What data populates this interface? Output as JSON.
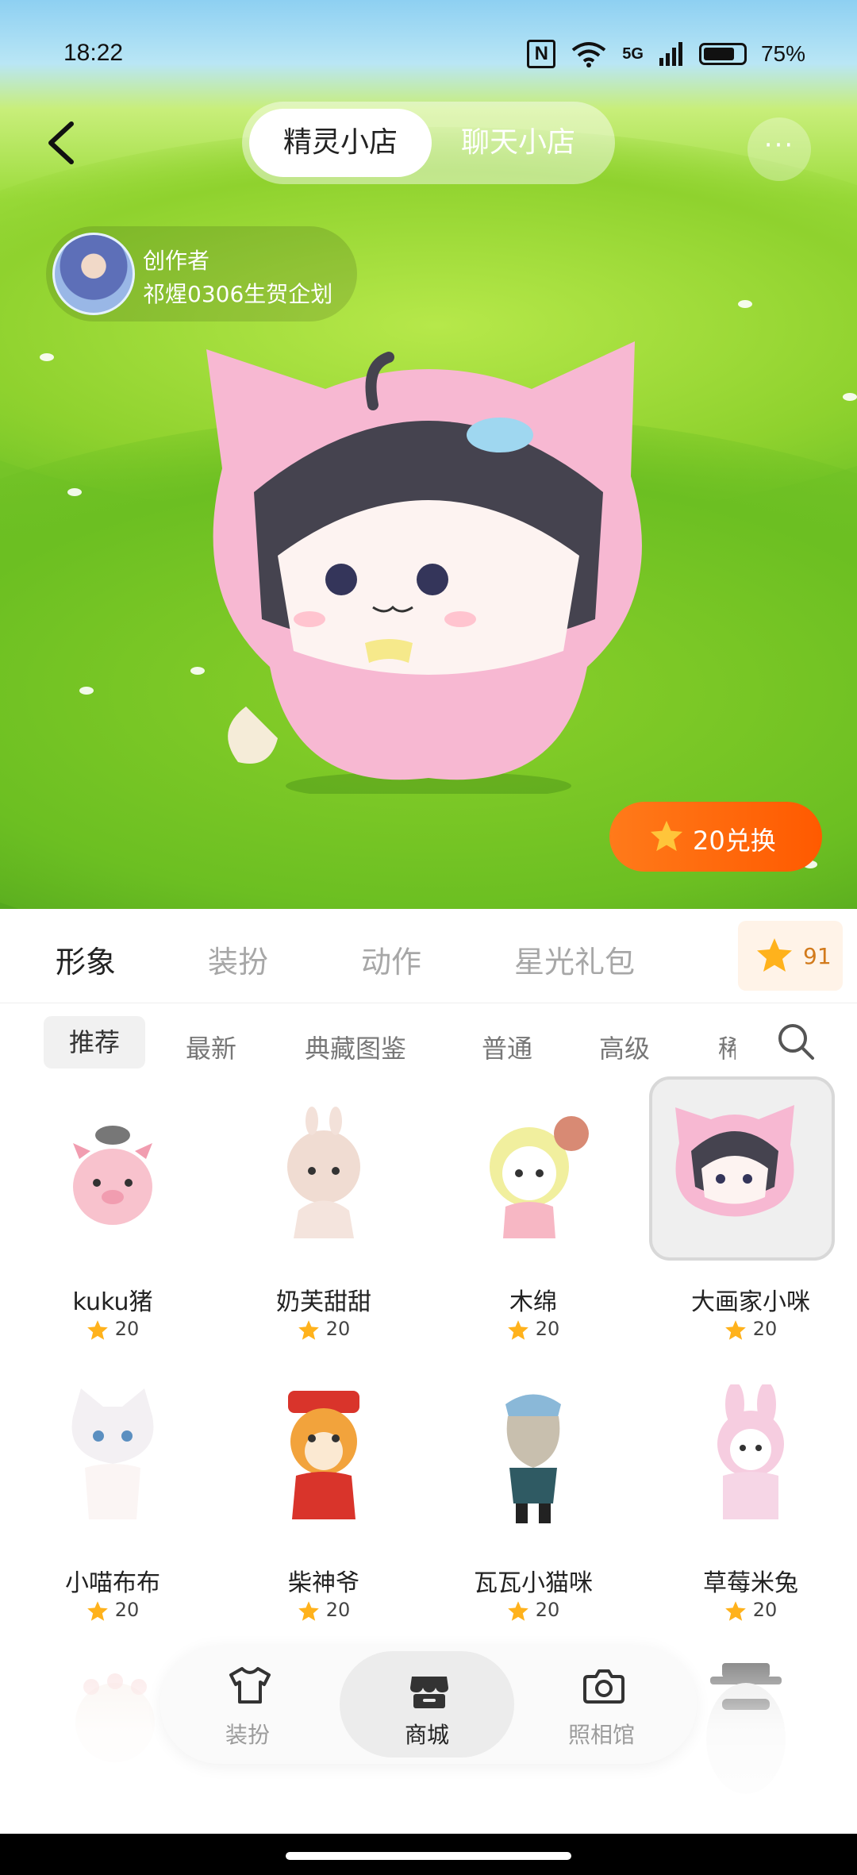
{
  "status_bar": {
    "time": "18:22",
    "nfc": "N",
    "network": "5G",
    "battery": "75%"
  },
  "header": {
    "tabs": [
      {
        "label": "精灵小店"
      },
      {
        "label": "聊天小店"
      }
    ],
    "more": "···"
  },
  "creator": {
    "label": "创作者",
    "name": "祁煋0306生贺企划"
  },
  "redeem_button": {
    "label": "20兑换"
  },
  "categories": [
    {
      "label": "形象"
    },
    {
      "label": "装扮"
    },
    {
      "label": "动作"
    },
    {
      "label": "星光礼包"
    }
  ],
  "star_balance": "91",
  "filters": [
    {
      "label": "推荐"
    },
    {
      "label": "最新"
    },
    {
      "label": "典藏图鉴"
    },
    {
      "label": "普通"
    },
    {
      "label": "高级"
    },
    {
      "label": "稀"
    }
  ],
  "items": [
    {
      "name": "kuku猪",
      "price": "20"
    },
    {
      "name": "奶芙甜甜",
      "price": "20"
    },
    {
      "name": "木绵",
      "price": "20"
    },
    {
      "name": "大画家小咪",
      "price": "20"
    },
    {
      "name": "小喵布布",
      "price": "20"
    },
    {
      "name": "柴神爷",
      "price": "20"
    },
    {
      "name": "瓦瓦小猫咪",
      "price": "20"
    },
    {
      "name": "草莓米兔",
      "price": "20"
    }
  ],
  "bottom_nav": [
    {
      "label": "装扮"
    },
    {
      "label": "商城"
    },
    {
      "label": "照相馆"
    }
  ],
  "colors": {
    "accent_orange": "#ff6a0a",
    "star_yellow": "#ffb21c"
  }
}
